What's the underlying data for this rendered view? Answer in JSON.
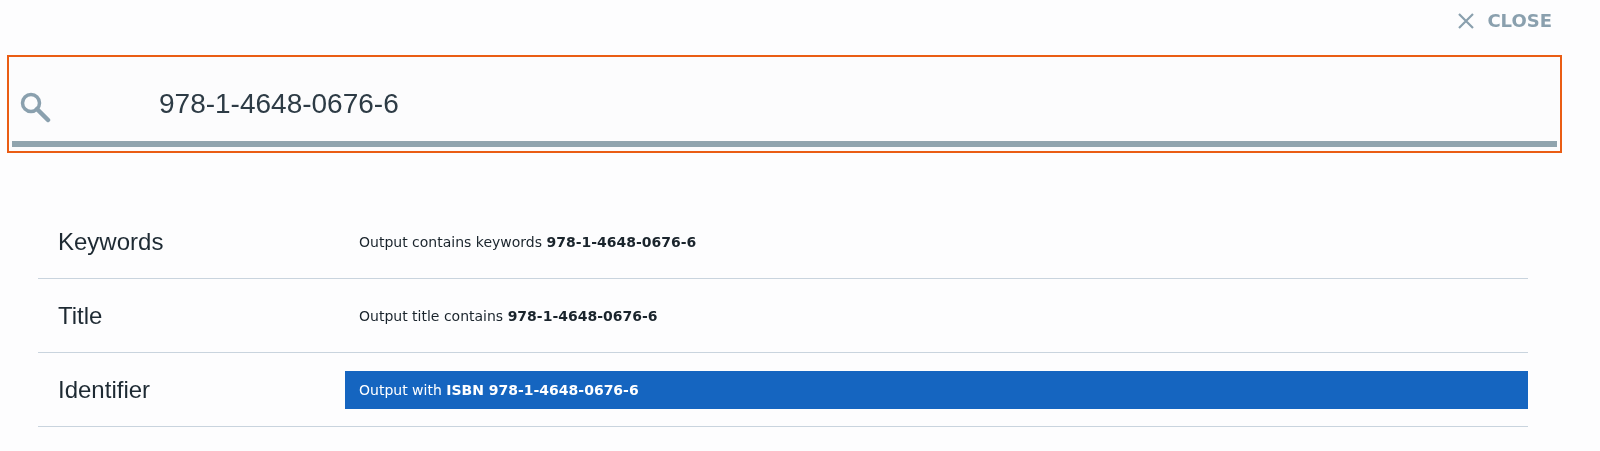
{
  "overlay": {
    "close": "CLOSE",
    "search": {
      "value": "978-1-4648-0676-6"
    },
    "suggestions": [
      {
        "field": "Keywords",
        "description": "Output contains keywords **978-1-4648-0676-6**",
        "selected": false
      },
      {
        "field": "Title",
        "description": "Output title contains **978-1-4648-0676-6**",
        "selected": false
      },
      {
        "field": "Identifier",
        "description": "Output with **ISBN 978-1-4648-0676-6**",
        "selected": true
      }
    ]
  }
}
